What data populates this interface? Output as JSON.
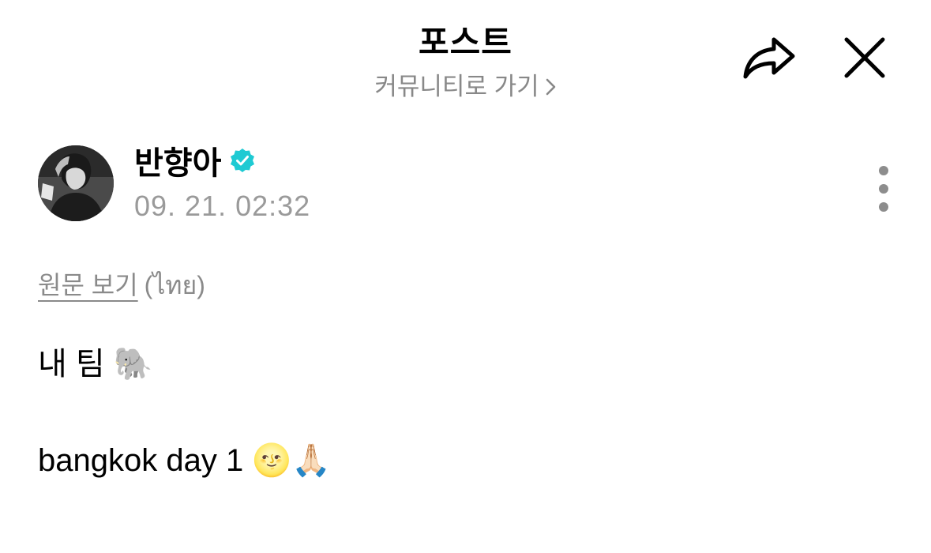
{
  "header": {
    "title": "포스트",
    "community_link": "커뮤니티로 가기",
    "share_icon": "share-arrow-icon",
    "close_icon": "close-icon"
  },
  "author": {
    "name": "반향아",
    "verified_icon": "verified-badge-icon",
    "verified_color": "#1ecad3",
    "timestamp": "09. 21. 02:32",
    "more_icon": "more-vertical-icon"
  },
  "translation": {
    "link_label": "원문 보기",
    "language": "(ไทย)"
  },
  "post": {
    "line1": "내 팀 🐘",
    "line2": "bangkok day 1 🌝🙏🏻"
  }
}
